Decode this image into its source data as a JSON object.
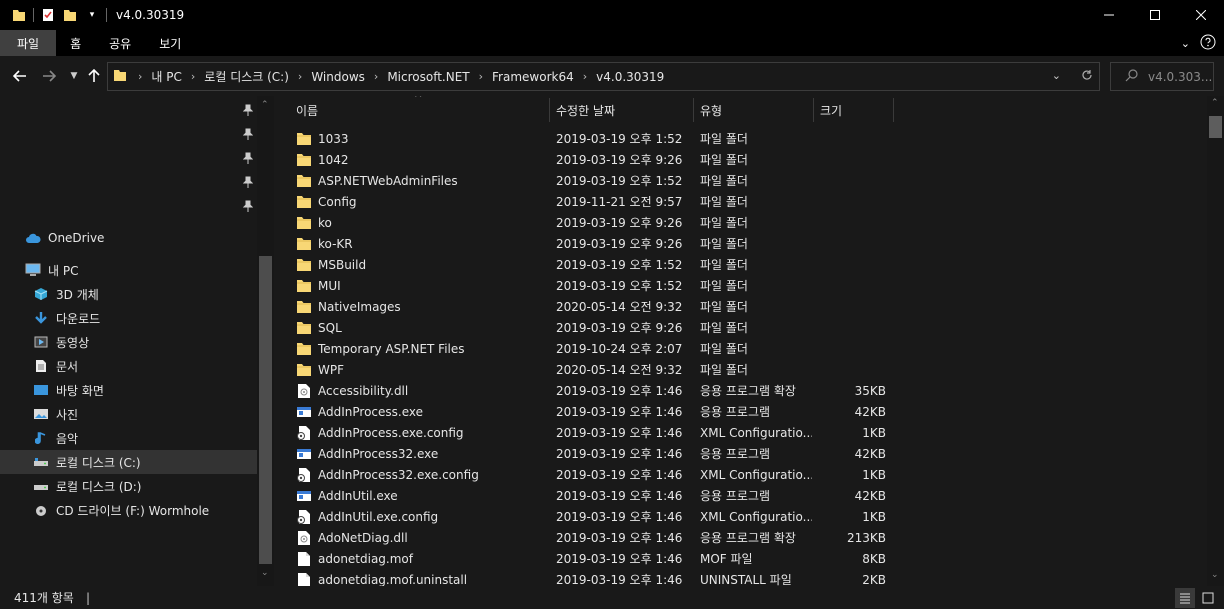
{
  "window": {
    "title": "v4.0.30319",
    "minimize_icon": "minimize-icon",
    "maximize_icon": "maximize-icon",
    "close_icon": "close-icon"
  },
  "ribbon": {
    "tabs": [
      {
        "label": "파일",
        "active": true
      },
      {
        "label": "홈",
        "active": false
      },
      {
        "label": "공유",
        "active": false
      },
      {
        "label": "보기",
        "active": false
      }
    ]
  },
  "address": {
    "crumbs": [
      "내 PC",
      "로컬 디스크 (C:)",
      "Windows",
      "Microsoft.NET",
      "Framework64",
      "v4.0.30319"
    ]
  },
  "search": {
    "placeholder": "v4.0.303..."
  },
  "nav": {
    "onedrive": "OneDrive",
    "thispc": "내 PC",
    "items": [
      {
        "label": "3D 개체",
        "icon": "3d-objects-icon"
      },
      {
        "label": "다운로드",
        "icon": "downloads-icon"
      },
      {
        "label": "동영상",
        "icon": "videos-icon"
      },
      {
        "label": "문서",
        "icon": "documents-icon"
      },
      {
        "label": "바탕 화면",
        "icon": "desktop-icon"
      },
      {
        "label": "사진",
        "icon": "pictures-icon"
      },
      {
        "label": "음악",
        "icon": "music-icon"
      },
      {
        "label": "로컬 디스크 (C:)",
        "icon": "drive-c-icon",
        "selected": true
      },
      {
        "label": "로컬 디스크 (D:)",
        "icon": "drive-d-icon"
      },
      {
        "label": "CD 드라이브 (F:) Wormhole",
        "icon": "cd-drive-icon"
      }
    ]
  },
  "columns": {
    "name": "이름",
    "date": "수정한 날짜",
    "type": "유형",
    "size": "크기"
  },
  "files": [
    {
      "name": "1033",
      "date": "2019-03-19 오후 1:52",
      "type": "파일 폴더",
      "size": "",
      "kind": "folder"
    },
    {
      "name": "1042",
      "date": "2019-03-19 오후 9:26",
      "type": "파일 폴더",
      "size": "",
      "kind": "folder"
    },
    {
      "name": "ASP.NETWebAdminFiles",
      "date": "2019-03-19 오후 1:52",
      "type": "파일 폴더",
      "size": "",
      "kind": "folder"
    },
    {
      "name": "Config",
      "date": "2019-11-21 오전 9:57",
      "type": "파일 폴더",
      "size": "",
      "kind": "folder"
    },
    {
      "name": "ko",
      "date": "2019-03-19 오후 9:26",
      "type": "파일 폴더",
      "size": "",
      "kind": "folder"
    },
    {
      "name": "ko-KR",
      "date": "2019-03-19 오후 9:26",
      "type": "파일 폴더",
      "size": "",
      "kind": "folder"
    },
    {
      "name": "MSBuild",
      "date": "2019-03-19 오후 1:52",
      "type": "파일 폴더",
      "size": "",
      "kind": "folder"
    },
    {
      "name": "MUI",
      "date": "2019-03-19 오후 1:52",
      "type": "파일 폴더",
      "size": "",
      "kind": "folder"
    },
    {
      "name": "NativeImages",
      "date": "2020-05-14 오전 9:32",
      "type": "파일 폴더",
      "size": "",
      "kind": "folder"
    },
    {
      "name": "SQL",
      "date": "2019-03-19 오후 9:26",
      "type": "파일 폴더",
      "size": "",
      "kind": "folder"
    },
    {
      "name": "Temporary ASP.NET Files",
      "date": "2019-10-24 오후 2:07",
      "type": "파일 폴더",
      "size": "",
      "kind": "folder"
    },
    {
      "name": "WPF",
      "date": "2020-05-14 오전 9:32",
      "type": "파일 폴더",
      "size": "",
      "kind": "folder"
    },
    {
      "name": "Accessibility.dll",
      "date": "2019-03-19 오후 1:46",
      "type": "응용 프로그램 확장",
      "size": "35KB",
      "kind": "dll"
    },
    {
      "name": "AddInProcess.exe",
      "date": "2019-03-19 오후 1:46",
      "type": "응용 프로그램",
      "size": "42KB",
      "kind": "exe"
    },
    {
      "name": "AddInProcess.exe.config",
      "date": "2019-03-19 오후 1:46",
      "type": "XML Configuratio...",
      "size": "1KB",
      "kind": "config"
    },
    {
      "name": "AddInProcess32.exe",
      "date": "2019-03-19 오후 1:46",
      "type": "응용 프로그램",
      "size": "42KB",
      "kind": "exe"
    },
    {
      "name": "AddInProcess32.exe.config",
      "date": "2019-03-19 오후 1:46",
      "type": "XML Configuratio...",
      "size": "1KB",
      "kind": "config"
    },
    {
      "name": "AddInUtil.exe",
      "date": "2019-03-19 오후 1:46",
      "type": "응용 프로그램",
      "size": "42KB",
      "kind": "exe"
    },
    {
      "name": "AddInUtil.exe.config",
      "date": "2019-03-19 오후 1:46",
      "type": "XML Configuratio...",
      "size": "1KB",
      "kind": "config"
    },
    {
      "name": "AdoNetDiag.dll",
      "date": "2019-03-19 오후 1:46",
      "type": "응용 프로그램 확장",
      "size": "213KB",
      "kind": "dll"
    },
    {
      "name": "adonetdiag.mof",
      "date": "2019-03-19 오후 1:46",
      "type": "MOF 파일",
      "size": "8KB",
      "kind": "file"
    },
    {
      "name": "adonetdiag.mof.uninstall",
      "date": "2019-03-19 오후 1:46",
      "type": "UNINSTALL 파일",
      "size": "2KB",
      "kind": "file"
    }
  ],
  "status": {
    "count": "411개 항목"
  },
  "colors": {
    "background": "#191919",
    "titlebar": "#000000",
    "folder": "#f8d775",
    "accent": "#3a96dd"
  }
}
